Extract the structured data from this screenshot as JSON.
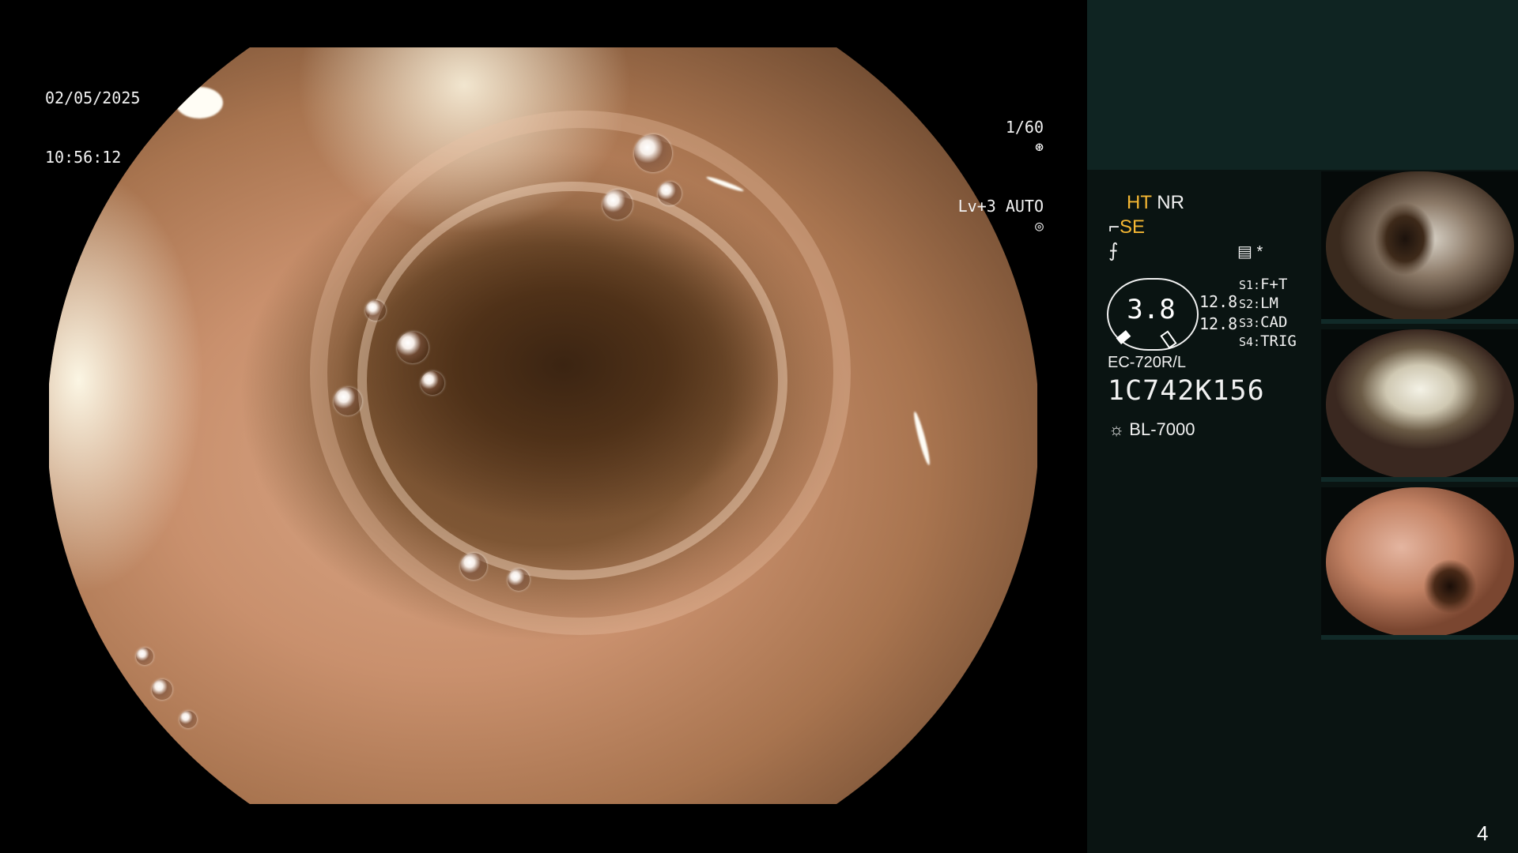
{
  "overlay": {
    "date": "02/05/2025",
    "time": "10:56:12",
    "shutter": "1/60",
    "level": "Lv+3 AUTO"
  },
  "panel": {
    "ht": "HT",
    "nr": "NR",
    "se": "SE",
    "dial_value": "3.8",
    "num_top": "12.8",
    "num_bottom": "12.8",
    "switches": [
      {
        "key": "S1:",
        "value": "F+T"
      },
      {
        "key": "S2:",
        "value": "LM"
      },
      {
        "key": "S3:",
        "value": "CAD"
      },
      {
        "key": "S4:",
        "value": "TRIG"
      }
    ],
    "model": "EC-720R/L",
    "serial": "1C742K156",
    "light_source": "BL-7000",
    "asterisk": "*"
  },
  "thumbnails": [
    {
      "name": "thumbnail-1"
    },
    {
      "name": "thumbnail-2"
    },
    {
      "name": "thumbnail-3"
    }
  ],
  "page_number": "4",
  "colors": {
    "accent_orange": "#f5b733",
    "panel_bg": "#0a1412",
    "panel_top_bg": "#0f2422"
  }
}
